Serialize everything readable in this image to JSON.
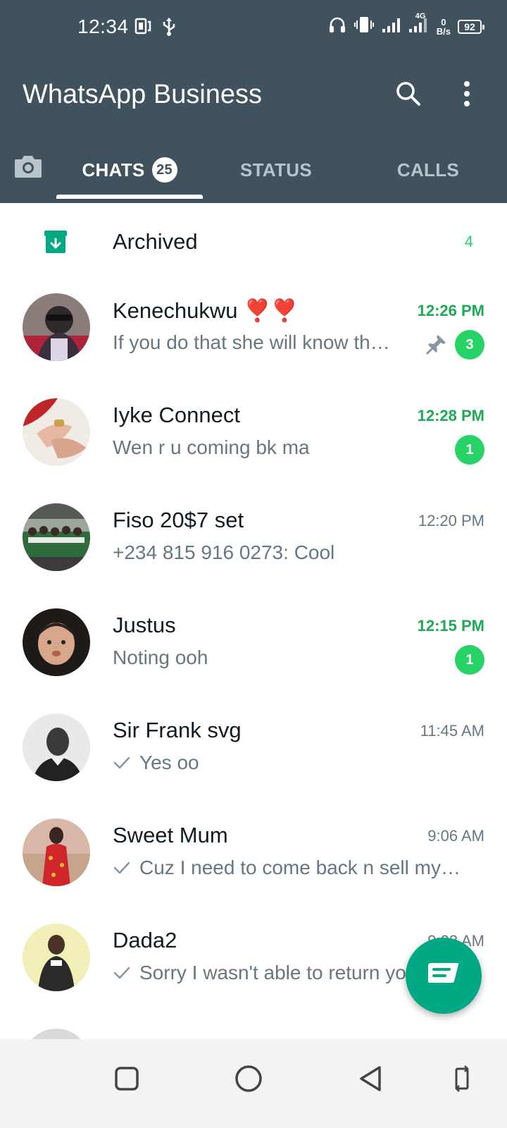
{
  "status_bar": {
    "time": "12:34",
    "network_speed_value": "0",
    "network_speed_unit": "B/s",
    "network_type": "4G",
    "battery": "92"
  },
  "header": {
    "title": "WhatsApp Business",
    "background_color": "#3f525e"
  },
  "tabs": [
    {
      "label": "CHATS",
      "badge": "25",
      "active": true
    },
    {
      "label": "STATUS",
      "active": false
    },
    {
      "label": "CALLS",
      "active": false
    }
  ],
  "archived": {
    "label": "Archived",
    "count": "4"
  },
  "chats": [
    {
      "name": "Kenechukwu ❣️❣️",
      "time": "12:26 PM",
      "message": "If you do that she will know th…",
      "unread": "3",
      "pinned": true,
      "avatar_color": "#6a4a4a"
    },
    {
      "name": "Iyke Connect",
      "time": "12:28 PM",
      "message": "Wen r u coming bk ma",
      "unread": "1",
      "avatar_color": "#c0392b"
    },
    {
      "name": "Fiso 20$7 set",
      "time": "12:20 PM",
      "message": "+234 815 916 0273: Cool",
      "avatar_color": "#3e6b4a"
    },
    {
      "name": "Justus",
      "time": "12:15 PM",
      "message": "Noting ooh",
      "unread": "1",
      "avatar_color": "#4a3a32"
    },
    {
      "name": "Sir Frank svg",
      "time": "11:45 AM",
      "message": "Yes oo",
      "delivered_tick": true,
      "avatar_color": "#4d4d4d"
    },
    {
      "name": "Sweet Mum",
      "time": "9:06 AM",
      "message": "Cuz I need to come back n sell my…",
      "delivered_tick": true,
      "avatar_color": "#c0392b"
    },
    {
      "name": "Dada2",
      "time": "9:03 AM",
      "message": "Sorry I wasn't able to return your call",
      "delivered_tick": true,
      "avatar_color": "#e9e3a8"
    }
  ],
  "colors": {
    "accent_green": "#25d366",
    "fab_green": "#00a884",
    "muted_text": "#667781"
  }
}
